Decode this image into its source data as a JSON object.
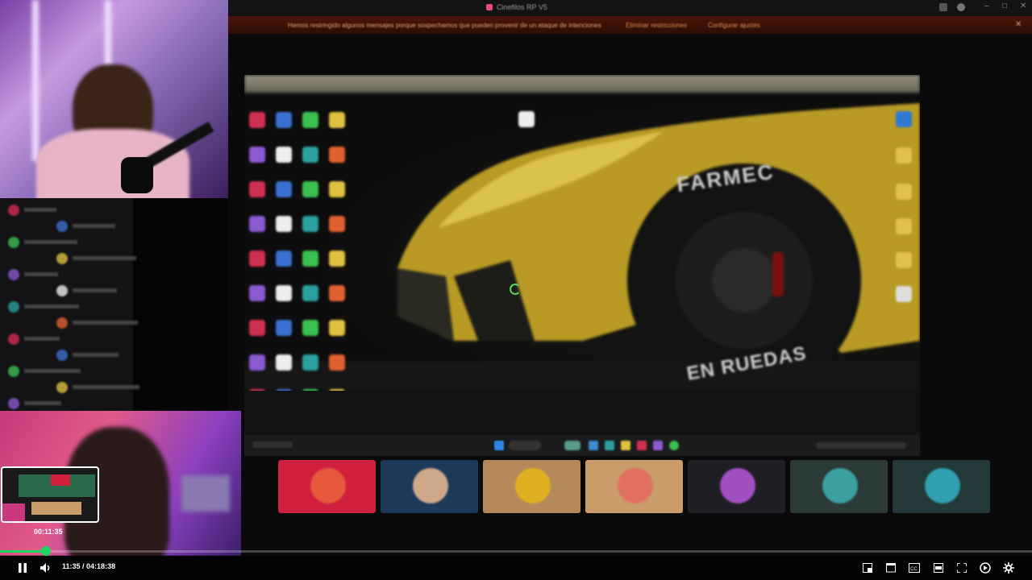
{
  "window": {
    "title": "Cinefilos RP V5"
  },
  "notice": {
    "message": "Hemos restringido algunos mensajes porque sospechamos que pueden provenir de un ataque de intenciones",
    "action_primary": "Eliminar restricciones",
    "action_secondary": "Configurar ajustes"
  },
  "wallpaper": {
    "tire_brand": "FARMEC",
    "tire_slogan": "EN RUEDAS",
    "car_color": "#d9b72c"
  },
  "player": {
    "current_time": "11:35",
    "total_time": "04:18:38",
    "time_separator": " / ",
    "preview_time": "00:11:35",
    "progress_fraction": 0.0448,
    "accent": "#1ed760",
    "buttons": [
      "pause-icon",
      "volume-icon",
      "miniplayer-icon",
      "theater-icon",
      "captions-icon",
      "pip-icon",
      "fullscreen-icon",
      "autoplay-icon",
      "settings-icon"
    ]
  },
  "tiles": [
    {
      "bg": "#d0203e",
      "avatar": "#e6593b"
    },
    {
      "bg": "#1d3a5a",
      "avatar": "#cfa88a"
    },
    {
      "bg": "#b58a5a",
      "avatar": "#e0b020"
    },
    {
      "bg": "#c99c6a",
      "avatar": "#e07060"
    },
    {
      "bg": "#1e1e24",
      "avatar": "#a050c0"
    },
    {
      "bg": "#2c3a38",
      "avatar": "#3aa0a0"
    },
    {
      "bg": "#24393a",
      "avatar": "#30a0b0"
    }
  ]
}
